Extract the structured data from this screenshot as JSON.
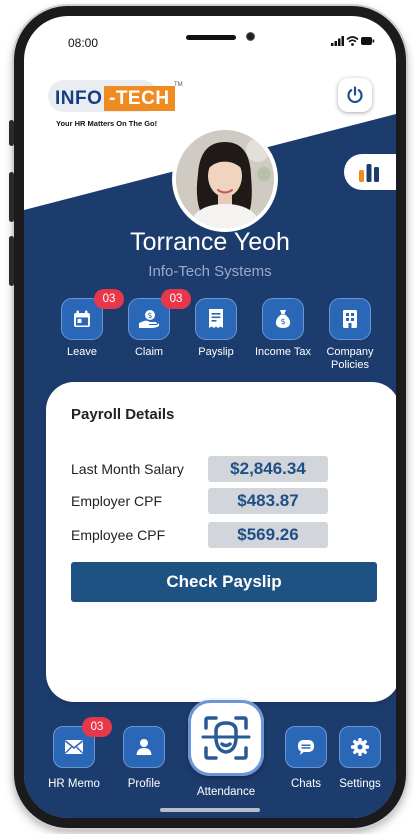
{
  "status_bar": {
    "time": "08:00"
  },
  "brand": {
    "name_part1": "INFO",
    "name_part2": "-TECH",
    "trademark": "TM",
    "tagline": "Your HR Matters On The Go!"
  },
  "profile": {
    "name": "Torrance Yeoh",
    "company": "Info-Tech Systems"
  },
  "quick_actions": [
    {
      "label": "Leave",
      "badge": "03",
      "icon": "calendar-icon"
    },
    {
      "label": "Claim",
      "badge": "03",
      "icon": "money-hand-icon"
    },
    {
      "label": "Payslip",
      "badge": "",
      "icon": "receipt-icon"
    },
    {
      "label": "Income Tax",
      "badge": "",
      "icon": "money-bag-icon"
    },
    {
      "label": "Company Policies",
      "badge": "",
      "icon": "building-icon"
    }
  ],
  "payroll": {
    "title": "Payroll Details",
    "rows": [
      {
        "label": "Last Month Salary",
        "value": "$2,846.34"
      },
      {
        "label": "Employer CPF",
        "value": "$483.87"
      },
      {
        "label": "Employee CPF",
        "value": "$569.26"
      }
    ],
    "button_label": "Check Payslip"
  },
  "bottom_nav": [
    {
      "label": "HR Memo",
      "badge": "03",
      "icon": "envelope-icon"
    },
    {
      "label": "Profile",
      "badge": "",
      "icon": "person-icon"
    },
    {
      "label": "Attendance",
      "badge": "",
      "icon": "face-scan-icon"
    },
    {
      "label": "Chats",
      "badge": "",
      "icon": "chat-icon"
    },
    {
      "label": "Settings",
      "badge": "",
      "icon": "gear-icon"
    }
  ],
  "colors": {
    "primary_navy": "#1d3c6e",
    "tile_blue": "#2a67b6",
    "badge_red": "#e8374a",
    "brand_orange": "#f08b21",
    "value_text": "#1e4f86"
  }
}
